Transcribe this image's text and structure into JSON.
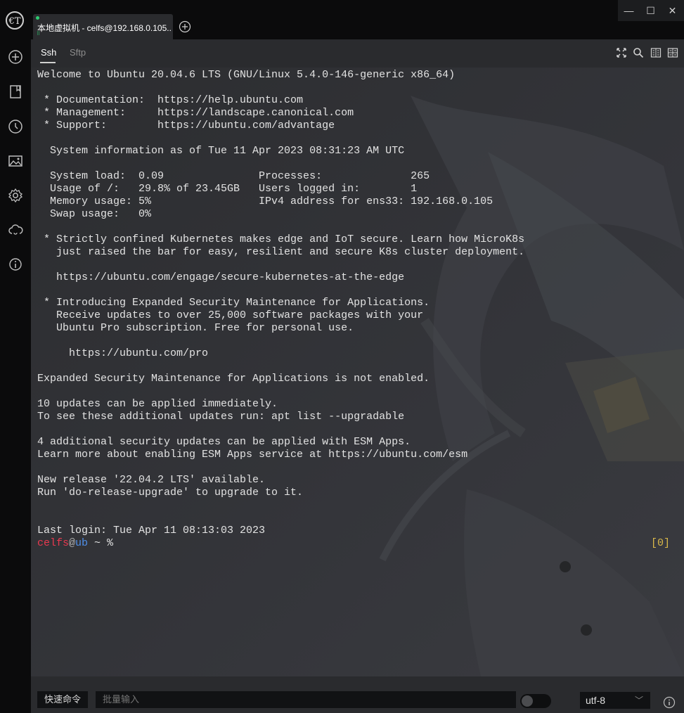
{
  "app": {
    "logo_text": "€T"
  },
  "tabs": [
    {
      "title": "本地虚拟机 - celfs@192.168.0.105...",
      "status_color": "#2ecc71"
    }
  ],
  "window_controls": {
    "minimize": "—",
    "maximize": "☐",
    "close": "✕"
  },
  "subtabs": [
    {
      "label": "Ssh",
      "active": true
    },
    {
      "label": "Sftp",
      "active": false
    }
  ],
  "toolbar_icons": [
    "fullscreen-icon",
    "search-icon",
    "split-vertical-icon",
    "split-grid-icon"
  ],
  "sidebar_icons": [
    "add-icon",
    "bookmark-icon",
    "history-icon",
    "image-icon",
    "settings-icon",
    "cloud-sync-icon",
    "info-icon"
  ],
  "terminal": {
    "output": "Welcome to Ubuntu 20.04.6 LTS (GNU/Linux 5.4.0-146-generic x86_64)\n\n * Documentation:  https://help.ubuntu.com\n * Management:     https://landscape.canonical.com\n * Support:        https://ubuntu.com/advantage\n\n  System information as of Tue 11 Apr 2023 08:31:23 AM UTC\n\n  System load:  0.09               Processes:              265\n  Usage of /:   29.8% of 23.45GB   Users logged in:        1\n  Memory usage: 5%                 IPv4 address for ens33: 192.168.0.105\n  Swap usage:   0%\n\n * Strictly confined Kubernetes makes edge and IoT secure. Learn how MicroK8s\n   just raised the bar for easy, resilient and secure K8s cluster deployment.\n\n   https://ubuntu.com/engage/secure-kubernetes-at-the-edge\n\n * Introducing Expanded Security Maintenance for Applications.\n   Receive updates to over 25,000 software packages with your\n   Ubuntu Pro subscription. Free for personal use.\n\n     https://ubuntu.com/pro\n\nExpanded Security Maintenance for Applications is not enabled.\n\n10 updates can be applied immediately.\nTo see these additional updates run: apt list --upgradable\n\n4 additional security updates can be applied with ESM Apps.\nLearn more about enabling ESM Apps service at https://ubuntu.com/esm\n\nNew release '22.04.2 LTS' available.\nRun 'do-release-upgrade' to upgrade to it.\n\n\nLast login: Tue Apr 11 08:13:03 2023",
    "prompt": {
      "user": "celfs",
      "at": "@",
      "host": "ub",
      "rest": " ~ %"
    },
    "jobs_indicator": "[0]",
    "colors": {
      "user": "#e8384f",
      "host": "#4f8fe8",
      "jobs": "#d9b84a"
    }
  },
  "bottom_bar": {
    "quick_command_label": "快速命令",
    "batch_input_placeholder": "批量输入",
    "batch_toggle_on": false,
    "encoding": "utf-8"
  }
}
